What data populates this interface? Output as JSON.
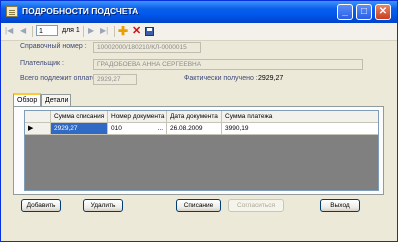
{
  "window": {
    "title": "ПОДРОБНОСТИ ПОДСЧЕТА"
  },
  "toolbar": {
    "position_value": "1",
    "of_label": "для 1"
  },
  "form": {
    "ref_label": "Справочный номер :",
    "ref_value": "10002000/180210/КЛ-0000015",
    "payer_label": "Плательщик :",
    "payer_value": "ГРАДОБОЕВА АННА СЕРГЕЕВНА",
    "total_label": "Всего подлежит оплате :",
    "total_value": "2929,27",
    "received_label": "Фактически получено :",
    "received_value": "2929,27"
  },
  "tabs": [
    {
      "label": "Обзор"
    },
    {
      "label": "Детали"
    }
  ],
  "table": {
    "columns": [
      "Сумма списания",
      "Номер документа",
      "Дата документа",
      "Сумма платежа"
    ],
    "rows": [
      [
        "2929,27",
        "010",
        "26.08.2009",
        "3990,19"
      ]
    ],
    "ellipsis": "..."
  },
  "buttons": {
    "add": "Добавить",
    "delete": "Удалить",
    "writeoff": "Списание",
    "agree": "Согласиться",
    "exit": "Выход"
  }
}
